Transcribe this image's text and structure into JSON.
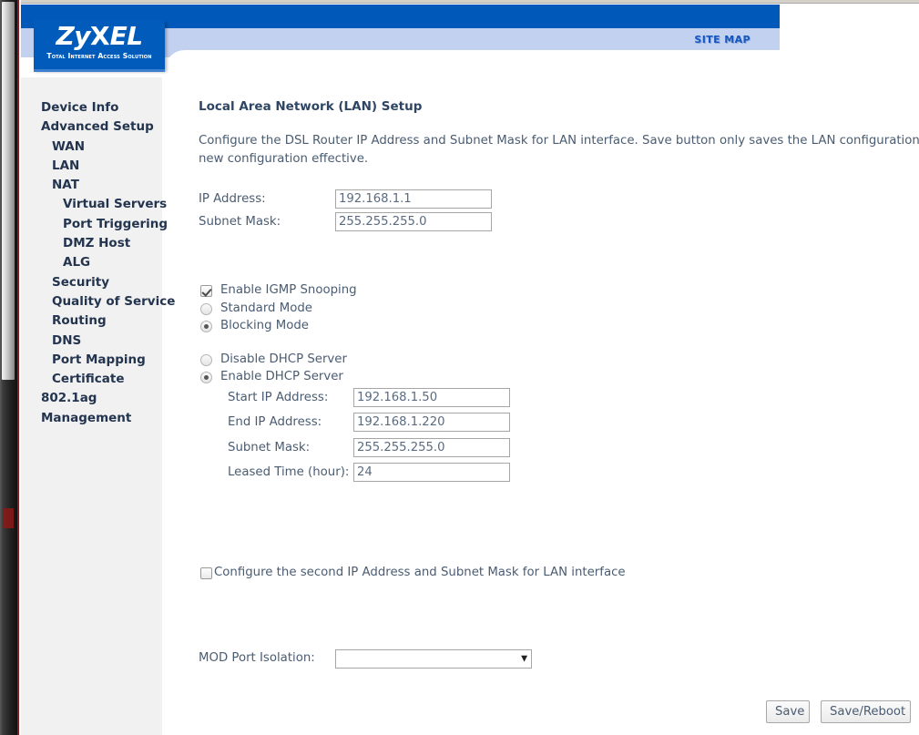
{
  "window": {
    "sitemap_label": "SITE MAP"
  },
  "logo": {
    "brand_zy": "Zy",
    "brand_x": "X",
    "brand_el": "EL",
    "tagline": "Total Internet Access Solution",
    "background_color": "#005bbb"
  },
  "sidebar": {
    "background_color": "#f1f1f1",
    "items": [
      {
        "label": "Device Info",
        "level": 0
      },
      {
        "label": "Advanced Setup",
        "level": 0
      },
      {
        "label": "WAN",
        "level": 1
      },
      {
        "label": "LAN",
        "level": 1
      },
      {
        "label": "NAT",
        "level": 1
      },
      {
        "label": "Virtual Servers",
        "level": 2
      },
      {
        "label": "Port Triggering",
        "level": 2
      },
      {
        "label": "DMZ Host",
        "level": 2
      },
      {
        "label": "ALG",
        "level": 2
      },
      {
        "label": "Security",
        "level": 1
      },
      {
        "label": "Quality of Service",
        "level": 1
      },
      {
        "label": "Routing",
        "level": 1
      },
      {
        "label": "DNS",
        "level": 1
      },
      {
        "label": "Port Mapping",
        "level": 1
      },
      {
        "label": "Certificate",
        "level": 1
      },
      {
        "label": "802.1ag",
        "level": 0
      },
      {
        "label": "Management",
        "level": 0
      }
    ]
  },
  "main": {
    "title": "Local Area Network (LAN) Setup",
    "description": "Configure the DSL Router IP Address and Subnet Mask for LAN interface.  Save button only saves the LAN configuration the new configuration effective.",
    "lan": {
      "ip_address_label": "IP Address:",
      "ip_address_value": "192.168.1.1",
      "subnet_mask_label": "Subnet Mask:",
      "subnet_mask_value": "255.255.255.0"
    },
    "igmp": {
      "enable_snooping_label": "Enable IGMP Snooping",
      "enable_snooping_checked": true,
      "standard_mode_label": "Standard Mode",
      "standard_mode_selected": false,
      "blocking_mode_label": "Blocking Mode",
      "blocking_mode_selected": true
    },
    "dhcp": {
      "disable_label": "Disable DHCP Server",
      "disable_selected": false,
      "enable_label": "Enable DHCP Server",
      "enable_selected": true,
      "start_ip_label": "Start IP Address:",
      "start_ip_value": "192.168.1.50",
      "end_ip_label": "End IP Address:",
      "end_ip_value": "192.168.1.220",
      "subnet_mask_label": "Subnet Mask:",
      "subnet_mask_value": "255.255.255.0",
      "leased_time_label": "Leased Time (hour):",
      "leased_time_value": "24"
    },
    "second_ip": {
      "label": "Configure the second IP Address and Subnet Mask for LAN interface",
      "checked": false
    },
    "mod_port_isolation": {
      "label": "MOD Port Isolation:",
      "value": "",
      "arrow_icon": "▼"
    },
    "buttons": {
      "save_label": "Save",
      "save_reboot_label": "Save/Reboot"
    }
  }
}
